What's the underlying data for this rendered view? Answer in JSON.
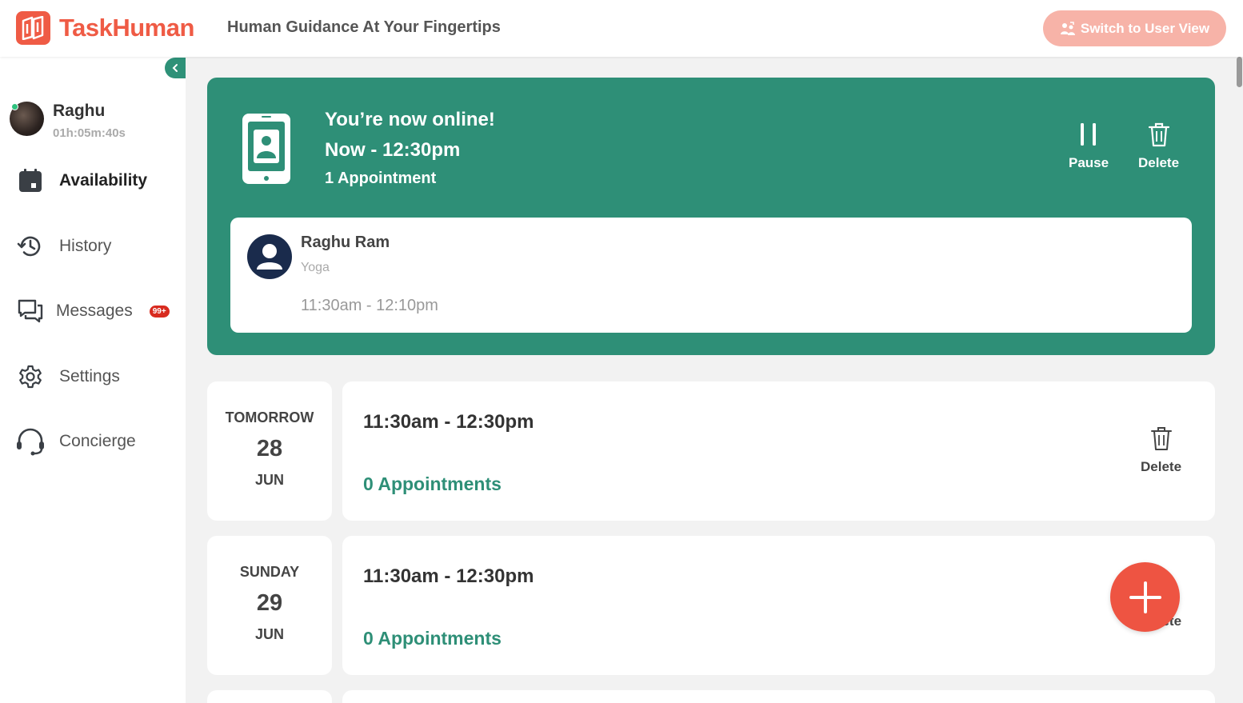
{
  "header": {
    "brand": "TaskHuman",
    "tagline": "Human Guidance At Your Fingertips",
    "switch_button": "Switch to User View"
  },
  "sidebar": {
    "profile": {
      "name": "Raghu",
      "online_time": "01h:05m:40s"
    },
    "items": [
      {
        "label": "Availability",
        "icon": "calendar-icon",
        "active": true
      },
      {
        "label": "History",
        "icon": "history-icon"
      },
      {
        "label": "Messages",
        "icon": "chat-icon",
        "badge": "99+"
      },
      {
        "label": "Settings",
        "icon": "gear-icon"
      },
      {
        "label": "Concierge",
        "icon": "headset-icon"
      }
    ]
  },
  "online_card": {
    "title": "You’re now online!",
    "now": "Now - 12:30pm",
    "count": "1 Appointment",
    "pause_label": "Pause",
    "delete_label": "Delete",
    "appointment": {
      "name": "Raghu Ram",
      "type": "Yoga",
      "time": "11:30am - 12:10pm"
    }
  },
  "slots": [
    {
      "day": "TOMORROW",
      "date": "28",
      "month": "JUN",
      "time": "11:30am - 12:30pm",
      "appointments": "0 Appointments",
      "delete_label": "Delete"
    },
    {
      "day": "SUNDAY",
      "date": "29",
      "month": "JUN",
      "time": "11:30am - 12:30pm",
      "appointments": "0 Appointments",
      "delete_label": "Delete"
    }
  ],
  "colors": {
    "brand": "#ef5b45",
    "accent_green": "#2e8f77",
    "badge_red": "#d82b1f"
  }
}
